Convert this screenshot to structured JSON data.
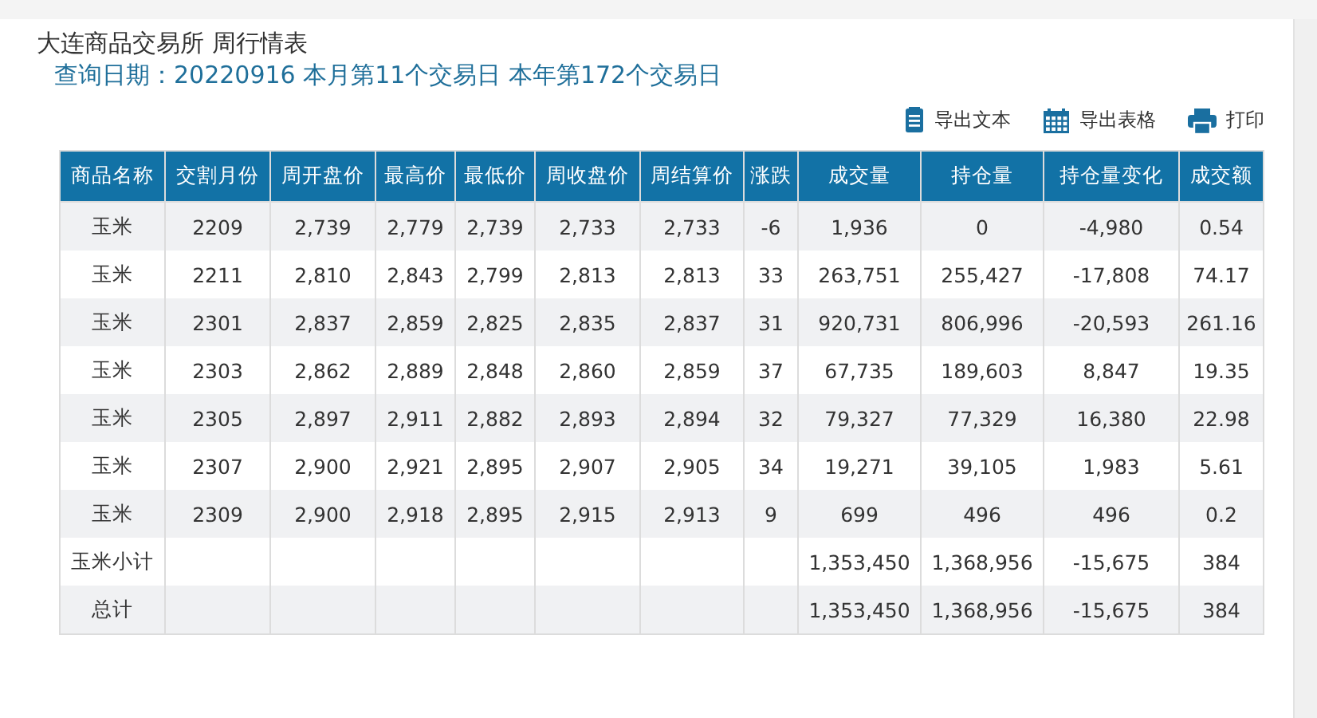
{
  "title": "大连商品交易所 周行情表",
  "query_date": "查询日期：20220916 本月第11个交易日 本年第172个交易日",
  "actions": [
    {
      "kind": "text",
      "label": "导出文本"
    },
    {
      "kind": "sheet",
      "label": "导出表格"
    },
    {
      "kind": "print",
      "label": "打印"
    }
  ],
  "table": {
    "columns": [
      "商品名称",
      "交割月份",
      "周开盘价",
      "最高价",
      "最低价",
      "周收盘价",
      "周结算价",
      "涨跌",
      "成交量",
      "持仓量",
      "持仓量变化",
      "成交额"
    ],
    "rows": [
      [
        "玉米",
        "2209",
        "2,739",
        "2,779",
        "2,739",
        "2,733",
        "2,733",
        "-6",
        "1,936",
        "0",
        "-4,980",
        "0.54"
      ],
      [
        "玉米",
        "2211",
        "2,810",
        "2,843",
        "2,799",
        "2,813",
        "2,813",
        "33",
        "263,751",
        "255,427",
        "-17,808",
        "74.17"
      ],
      [
        "玉米",
        "2301",
        "2,837",
        "2,859",
        "2,825",
        "2,835",
        "2,837",
        "31",
        "920,731",
        "806,996",
        "-20,593",
        "261.16"
      ],
      [
        "玉米",
        "2303",
        "2,862",
        "2,889",
        "2,848",
        "2,860",
        "2,859",
        "37",
        "67,735",
        "189,603",
        "8,847",
        "19.35"
      ],
      [
        "玉米",
        "2305",
        "2,897",
        "2,911",
        "2,882",
        "2,893",
        "2,894",
        "32",
        "79,327",
        "77,329",
        "16,380",
        "22.98"
      ],
      [
        "玉米",
        "2307",
        "2,900",
        "2,921",
        "2,895",
        "2,907",
        "2,905",
        "34",
        "19,271",
        "39,105",
        "1,983",
        "5.61"
      ],
      [
        "玉米",
        "2309",
        "2,900",
        "2,918",
        "2,895",
        "2,915",
        "2,913",
        "9",
        "699",
        "496",
        "496",
        "0.2"
      ],
      [
        "玉米小计",
        null,
        null,
        null,
        null,
        null,
        null,
        null,
        "1,353,450",
        "1,368,956",
        "-15,675",
        "384"
      ],
      [
        "总计",
        null,
        null,
        null,
        null,
        null,
        null,
        null,
        "1,353,450",
        "1,368,956",
        "-15,675",
        "384"
      ]
    ]
  }
}
